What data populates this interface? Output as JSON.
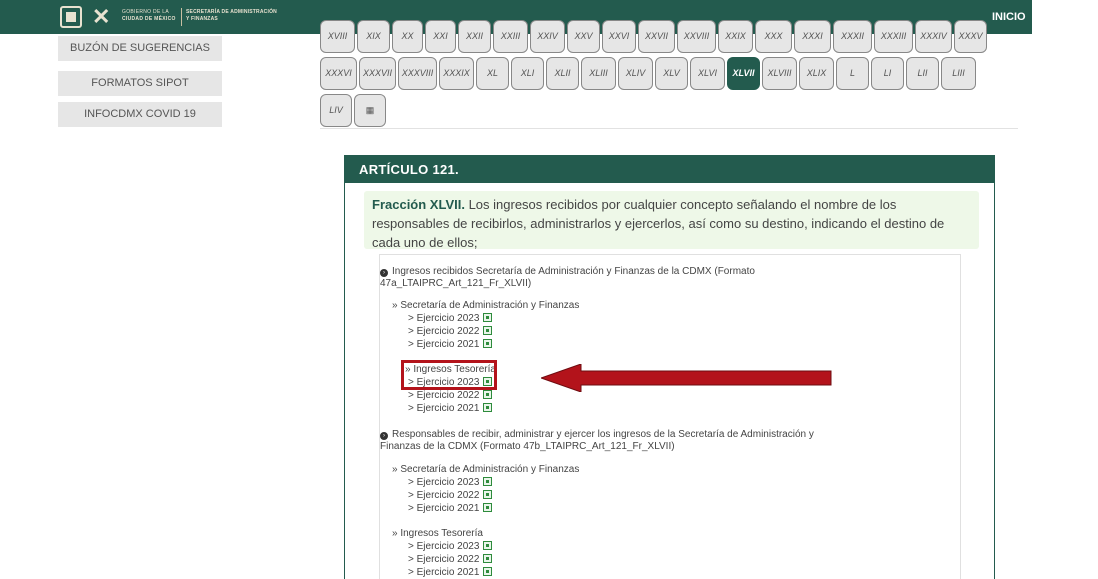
{
  "header": {
    "gov_line1": "GOBIERNO DE LA",
    "gov_line2": "CIUDAD DE MÉXICO",
    "sec_line1": "SECRETARÍA DE ADMINISTRACIÓN",
    "sec_line2": "Y FINANZAS",
    "nav_inicio": "INICIO",
    "colors": {
      "brand": "#235b4e",
      "accent": "#e8e2d0"
    }
  },
  "sidebar": {
    "items": [
      {
        "label": "BUZÓN DE SUGERENCIAS"
      },
      {
        "label": "FORMATOS SIPOT"
      },
      {
        "label": "INFOCDMX COVID 19"
      }
    ]
  },
  "fractions": {
    "row1": [
      "XVIII",
      "XIX",
      "XX",
      "XXI",
      "XXII",
      "XXIII",
      "XXIV",
      "XXV",
      "XXVI",
      "XXVII",
      "XXVIII",
      "XXIX",
      "XXX",
      "XXXI",
      "XXXII",
      "XXXIII",
      "XXXIV",
      "XXXV"
    ],
    "row2": [
      "XXXVI",
      "XXXVII",
      "XXXVIII",
      "XXXIX",
      "XL",
      "XLI",
      "XLII",
      "XLIII",
      "XLIV",
      "XLV",
      "XLVI",
      "XLVII",
      "XLVIII",
      "XLIX",
      "L",
      "LI",
      "LII",
      "LIII"
    ],
    "row3": [
      "LIV"
    ],
    "active": "XLVII",
    "table_icon": "table-icon"
  },
  "article": {
    "title": "ARTÍCULO 121.",
    "fraction_label": "Fracción XLVII.",
    "fraction_text": " Los ingresos recibidos por cualquier concepto señalando el nombre de los responsables de recibirlos, administrarlos y ejercerlos, así como su destino, indicando el destino de cada uno de ellos;"
  },
  "section_a": {
    "title_line1": "Ingresos recibidos Secretaría de Administración y Finanzas de la CDMX (Formato",
    "title_line2": "47a_LTAIPRC_Art_121_Fr_XLVII)",
    "group1_label": "» Secretaría de Administración y Finanzas",
    "group1_items": [
      "> Ejercicio 2023",
      "> Ejercicio 2022",
      "> Ejercicio 2021"
    ],
    "group2_label": "» Ingresos Tesorería",
    "group2_items": [
      "> Ejercicio 2023",
      "> Ejercicio 2022",
      "> Ejercicio 2021"
    ]
  },
  "section_b": {
    "title_line1": "Responsables de recibir, administrar y ejercer los ingresos de la Secretaría de Administración y",
    "title_line2": "Finanzas de la CDMX (Formato 47b_LTAIPRC_Art_121_Fr_XLVII)",
    "group1_label": "» Secretaría de Administración y Finanzas",
    "group1_items": [
      "> Ejercicio 2023",
      "> Ejercicio 2022",
      "> Ejercicio 2021"
    ],
    "group2_label": "» Ingresos Tesorería",
    "group2_items": [
      "> Ejercicio 2023",
      "> Ejercicio 2022",
      "> Ejercicio 2021"
    ]
  },
  "annotation": {
    "color": "#b3131b"
  }
}
